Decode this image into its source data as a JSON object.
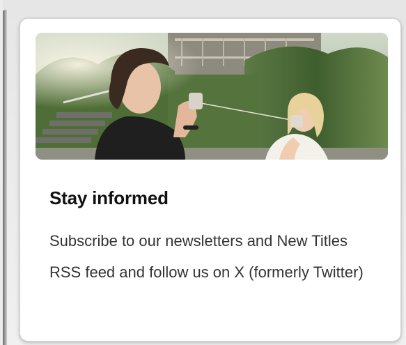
{
  "card": {
    "title": "Stay informed",
    "description": "Subscribe to our newsletters and New Titles RSS feed and follow us on X (formerly Twitter)"
  },
  "colors": {
    "card_background": "#ffffff",
    "title_text": "#111111",
    "body_text": "#333333",
    "page_background": "#ececec"
  }
}
